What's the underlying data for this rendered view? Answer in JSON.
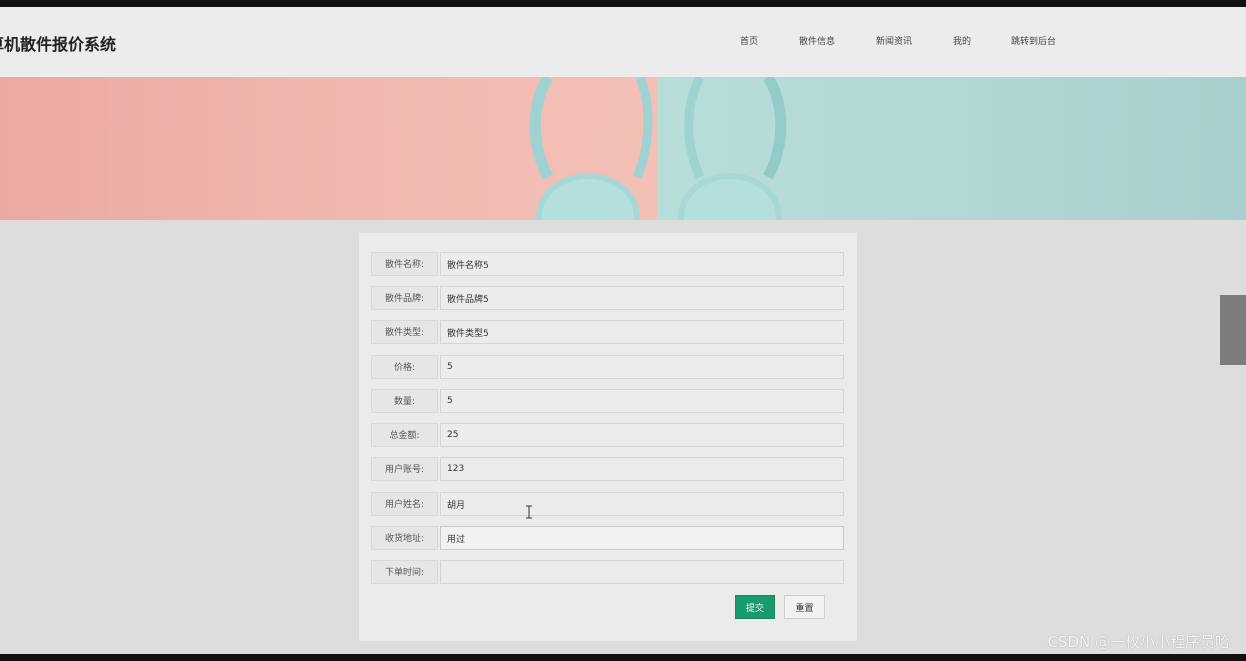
{
  "header": {
    "site_title": "算机散件报价系统",
    "nav": [
      "首页",
      "散件信息",
      "新闻资讯",
      "我的",
      "跳转到后台"
    ]
  },
  "banner": {
    "left_color": "#eba9a4",
    "right_color": "#b2d8d6",
    "headphone_color": "#a8d8d6"
  },
  "form": {
    "rows": [
      {
        "label": "散件名称:",
        "value": "散件名称5"
      },
      {
        "label": "散件品牌:",
        "value": "散件品牌5"
      },
      {
        "label": "散件类型:",
        "value": "散件类型5"
      },
      {
        "label": "价格:",
        "value": "5"
      },
      {
        "label": "数量:",
        "value": "5"
      },
      {
        "label": "总金额:",
        "value": "25"
      },
      {
        "label": "用户账号:",
        "value": "123"
      },
      {
        "label": "用户姓名:",
        "value": "胡月"
      },
      {
        "label": "收货地址:",
        "value": "用过"
      },
      {
        "label": "下单时间:",
        "value": ""
      }
    ],
    "submit_label": "提交",
    "reset_label": "重置",
    "submit_color": "#1a9b6b"
  },
  "cursor_icon": "text-cursor-icon",
  "watermark": "CSDN @一枚小小程序员哈"
}
